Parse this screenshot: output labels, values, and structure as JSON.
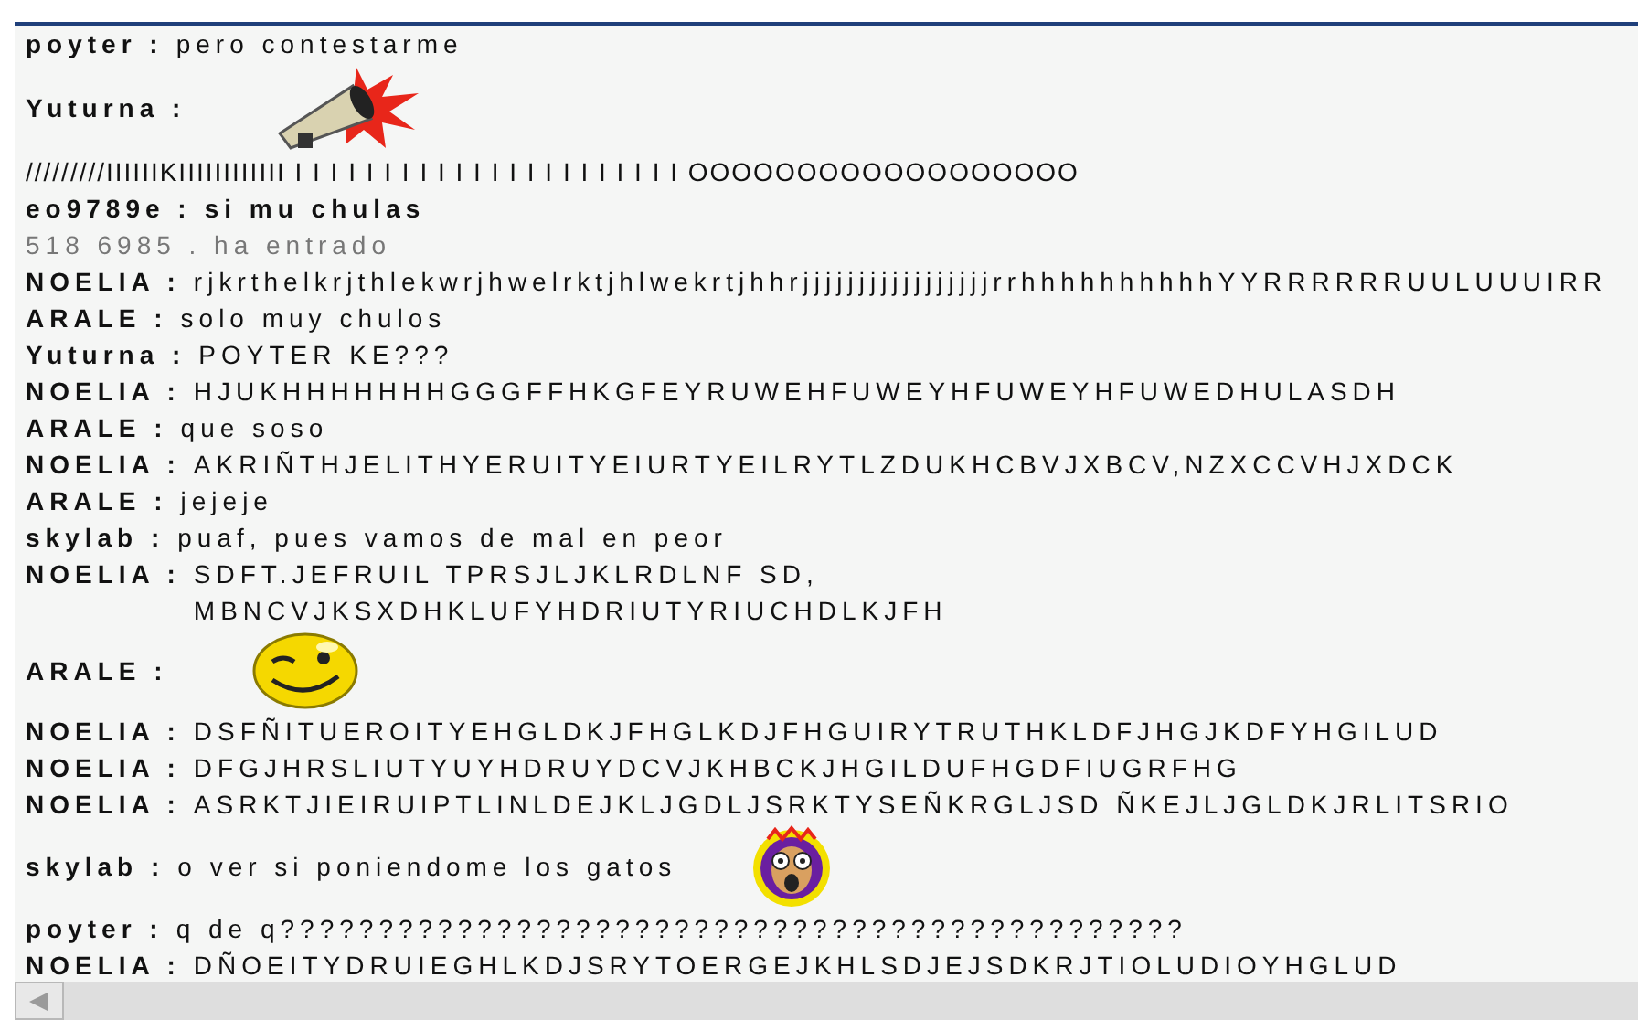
{
  "messages": [
    {
      "kind": "text",
      "user": "poyter :",
      "text": "pero contestarme"
    },
    {
      "kind": "megaphone",
      "user": "Yuturna :"
    },
    {
      "kind": "plain",
      "text": "/////////IIIIIIKIIIIIIIIIIII I I I I I I I I I I I I I I I I I I I I I I OOOOOOOOOOOOOOOOOO"
    },
    {
      "kind": "text",
      "user": "eo9789e :",
      "text": "si mu chulas",
      "bold_text": true
    },
    {
      "kind": "system",
      "text": "518  6985 . ha entrado"
    },
    {
      "kind": "text",
      "user": "NOELIA :",
      "text": "rjkrthelkrjthlekwrjhwelrktjhlwekrtjhhrjjjjjjjjjjjjjjjjjrrhhhhhhhhhhYYRRRRRRUULUUUIRR"
    },
    {
      "kind": "text",
      "user": "ARALE :",
      "text": "solo muy chulos"
    },
    {
      "kind": "text",
      "user": "Yuturna :",
      "text": "POYTER KE???"
    },
    {
      "kind": "text",
      "user": "NOELIA :",
      "text": "HJUKHHHHHHHGGGFFHKGFEYRUWEHFUWEYHFUWEYHFUWEDHULASDH"
    },
    {
      "kind": "text",
      "user": "ARALE :",
      "text": "que soso"
    },
    {
      "kind": "text",
      "user": "NOELIA :",
      "text": "AKRIÑTHJELITHYERUITYEIURTYEILRYTLZDUKHCBVJXBCV,NZXCCVHJXDCK"
    },
    {
      "kind": "text",
      "user": "ARALE :",
      "text": "jejeje"
    },
    {
      "kind": "text",
      "user": "skylab :",
      "text": "puaf, pues vamos de mal en peor"
    },
    {
      "kind": "text",
      "user": "NOELIA :",
      "text": "SDFT.JEFRUIL TPRSJLJKLRDLNF SD,\nMBNCVJKSXDHKLUFYHDRIUTYRIUCHDLKJFH"
    },
    {
      "kind": "wink",
      "user": "ARALE :"
    },
    {
      "kind": "text",
      "user": "NOELIA :",
      "text": "DSFÑITUEROITYEHGLDKJFHGLKDJFHGUIRYTRUTHKLDFJHGJKDFYHGILUD"
    },
    {
      "kind": "text",
      "user": "NOELIA :",
      "text": "DFGJHRSLIUTYUYHDRUYDCVJKHBCKJHGILDUFHGDFIUGRFHG"
    },
    {
      "kind": "text",
      "user": "NOELIA :",
      "text": "ASRKTJIEIRUIPTLINLDEJKLJGDLJSRKTYSEÑKRGLJSD ÑKEJLJGLDKJRLITSRIO"
    },
    {
      "kind": "scream",
      "user": "skylab :",
      "text": "o ver si poniendome los gatos"
    },
    {
      "kind": "text",
      "user": "poyter :",
      "text": "q  de q??????????????????????????????????????????????"
    },
    {
      "kind": "text",
      "user": "NOELIA :",
      "text": "DÑOEITYDRUIEGHLKDJSRYTOERGEJKHLSDJEJSDKRJTIOLUDIOYHGLUD"
    }
  ]
}
